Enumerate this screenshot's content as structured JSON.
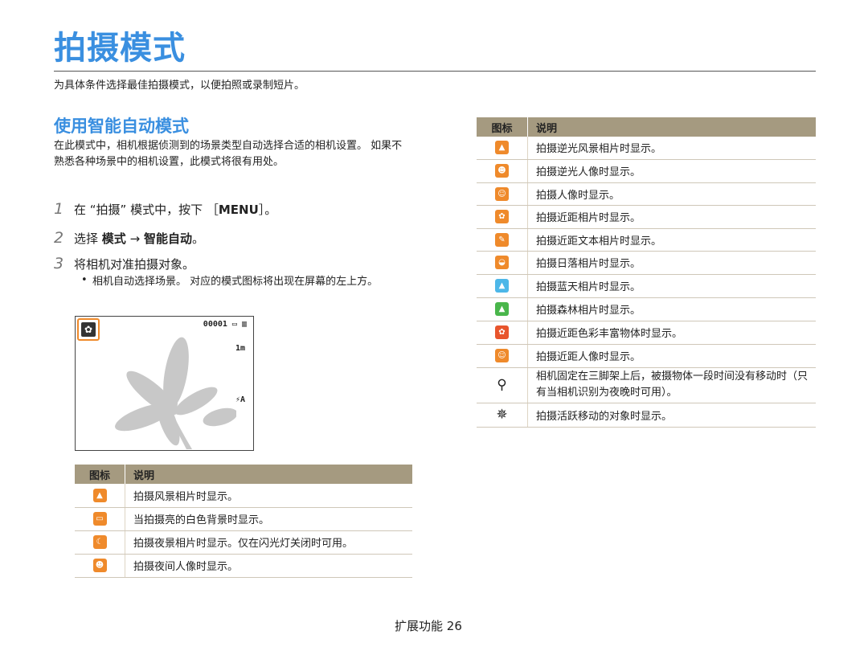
{
  "header": {
    "title": "拍摄模式",
    "intro": "为具体条件选择最佳拍摄模式，以便拍照或录制短片。"
  },
  "section": {
    "title": "使用智能自动模式",
    "description": "在此模式中，相机根据侦测到的场景类型自动选择合适的相机设置。 如果不熟悉各种场景中的相机设置，此模式将很有用处。"
  },
  "steps": [
    {
      "num": "1",
      "text_before": "在 “拍摄” 模式中，按下 ［",
      "key": "MENU",
      "text_after": "］。"
    },
    {
      "num": "2",
      "text_before": "选择",
      "bold1": "模式",
      "arrow": "→",
      "bold2": "智能自动",
      "text_after": "。"
    },
    {
      "num": "3",
      "text": "将相机对准拍摄对象。"
    }
  ],
  "bullet": "相机自动选择场景。 对应的模式图标将出现在屏幕的左上方。",
  "camera_screen": {
    "counter": "00001",
    "size_indicator": "1m",
    "flash_indicator": "⚡A",
    "mode_icon": "macro-flower-icon"
  },
  "table_headers": {
    "icon": "图标",
    "desc": "说明"
  },
  "left_table": [
    {
      "icon": "landscape-icon",
      "color": "#ef8a2b",
      "desc": "拍摄风景相片时显示。"
    },
    {
      "icon": "white-icon",
      "color": "#ef8a2b",
      "desc": "当拍摄亮的白色背景时显示。"
    },
    {
      "icon": "night-icon",
      "color": "#ef8a2b",
      "desc": "拍摄夜景相片时显示。仅在闪光灯关闭时可用。"
    },
    {
      "icon": "night-portrait-icon",
      "color": "#ef8a2b",
      "desc": "拍摄夜间人像时显示。"
    }
  ],
  "right_table": [
    {
      "icon": "backlight-landscape-icon",
      "color": "#ef8a2b",
      "desc": "拍摄逆光风景相片时显示。"
    },
    {
      "icon": "backlight-portrait-icon",
      "color": "#ef8a2b",
      "desc": "拍摄逆光人像时显示。"
    },
    {
      "icon": "portrait-icon",
      "color": "#ef8a2b",
      "desc": "拍摄人像时显示。"
    },
    {
      "icon": "macro-icon",
      "color": "#ef8a2b",
      "desc": "拍摄近距相片时显示。"
    },
    {
      "icon": "macro-text-icon",
      "color": "#ef8a2b",
      "desc": "拍摄近距文本相片时显示。"
    },
    {
      "icon": "sunset-icon",
      "color": "#ef8a2b",
      "desc": "拍摄日落相片时显示。"
    },
    {
      "icon": "blue-sky-icon",
      "color": "#4db7e8",
      "desc": "拍摄蓝天相片时显示。"
    },
    {
      "icon": "forest-icon",
      "color": "#49b64b",
      "desc": "拍摄森林相片时显示。"
    },
    {
      "icon": "macro-color-icon",
      "color": "#e8552c",
      "desc": "拍摄近距色彩丰富物体时显示。"
    },
    {
      "icon": "macro-portrait-icon",
      "color": "#ef8a2b",
      "desc": "拍摄近距人像时显示。"
    },
    {
      "icon": "tripod-icon",
      "color": "#222222",
      "desc": "相机固定在三脚架上后，被摄物体一段时间没有移动时（只有当相机识别为夜晚时可用）。"
    },
    {
      "icon": "action-icon",
      "color": "#222222",
      "desc": "拍摄活跃移动的对象时显示。"
    }
  ],
  "footer": {
    "label": "扩展功能",
    "page": "26"
  },
  "colors": {
    "accent": "#3a8fe0",
    "table_header": "#a59a80",
    "icon_orange": "#ef8a2b"
  }
}
